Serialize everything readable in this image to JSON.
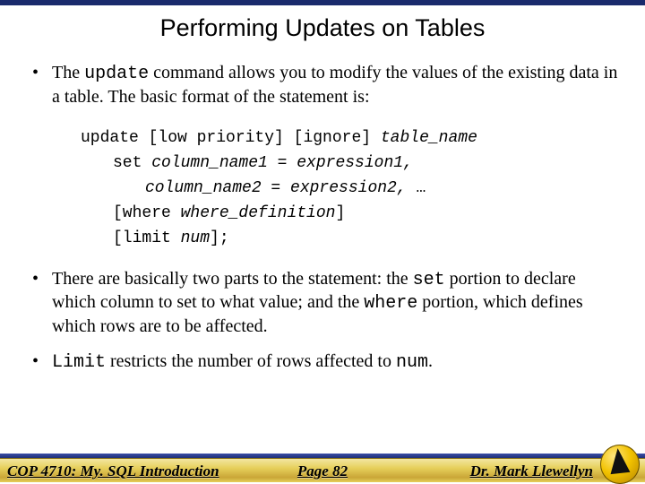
{
  "title": "Performing Updates on Tables",
  "bullets": {
    "b1_pre": "The ",
    "b1_code": "update",
    "b1_post": " command allows you to modify the values of the existing data in a table.  The basic format of the statement is:",
    "b2_a": "There are basically two parts to the statement: the ",
    "b2_code1": "set",
    "b2_b": " portion to declare which column to set to what value; and the ",
    "b2_code2": "where",
    "b2_c": " portion, which defines which rows are to be affected.",
    "b3_code": "Limit",
    "b3_mid": " restricts the number of rows affected to ",
    "b3_code2": "num",
    "b3_end": "."
  },
  "code": {
    "l1a": "update [low priority] [ignore] ",
    "l1b": "table_name",
    "l2a": "set ",
    "l2b": "column_name1 = expression1,",
    "l3a": "column_name2 = expression2, ",
    "l3b": "…",
    "l4a": "[where ",
    "l4b": "where_definition",
    "l4c": "]",
    "l5a": "[limit ",
    "l5b": "num",
    "l5c": "];"
  },
  "footer": {
    "left": "COP 4710: My. SQL Introduction",
    "center": "Page 82",
    "right": "Dr. Mark Llewellyn"
  }
}
